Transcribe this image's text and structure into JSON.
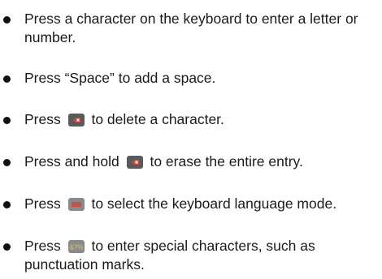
{
  "items": [
    {
      "text": "Press a character on the keyboard to enter a letter or number."
    },
    {
      "text": "Press “Space” to add a space."
    },
    {
      "pre": "Press",
      "icon": "backspace-key-icon",
      "post": "to delete a character."
    },
    {
      "pre": "Press and hold",
      "icon": "backspace-key-icon",
      "post": "to erase the entire entry."
    },
    {
      "pre": "Press",
      "icon": "language-key-icon",
      "post": "to select the keyboard language mode."
    },
    {
      "pre": "Press",
      "icon": "symbols-key-icon",
      "icon_label": "&?%",
      "post": "to enter special characters, such as punctuation marks."
    }
  ],
  "colors": {
    "text": "#1a1a1a",
    "key_dark": "#5a5a5a",
    "key_red": "#c94a3a",
    "key_gray": "#8a8a8a"
  }
}
